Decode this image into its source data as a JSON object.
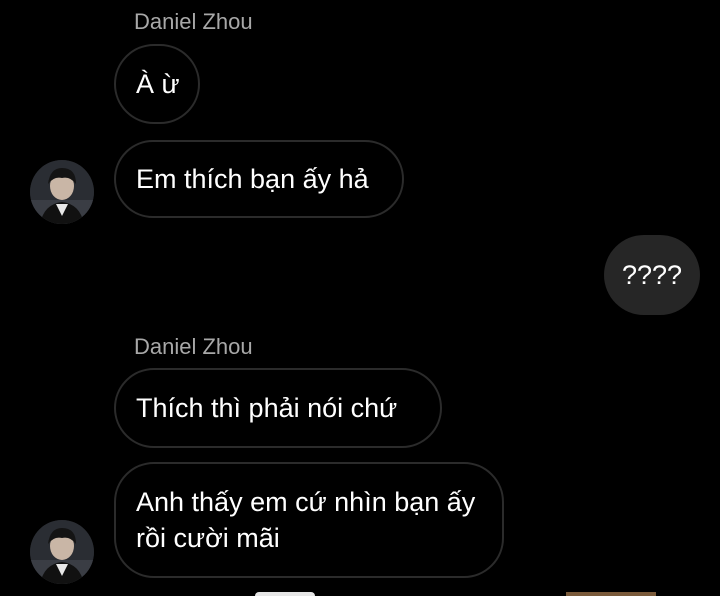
{
  "colors": {
    "background": "#000000",
    "sender_name": "#a8a8a8",
    "incoming_border": "#2b2b2b",
    "outgoing_bubble": "#262626",
    "text": "#ffffff"
  },
  "conversation": {
    "group1": {
      "sender": "Daniel Zhou",
      "messages": [
        "À ừ",
        "Em thích bạn ấy hả"
      ],
      "avatar_icon": "profile-photo"
    },
    "outgoing": {
      "message": "????"
    },
    "group2": {
      "sender": "Daniel Zhou",
      "messages": [
        "Thích thì phải nói chứ",
        "Anh thấy em cứ nhìn bạn ấy rồi cười mãi"
      ],
      "avatar_icon": "profile-photo"
    }
  }
}
